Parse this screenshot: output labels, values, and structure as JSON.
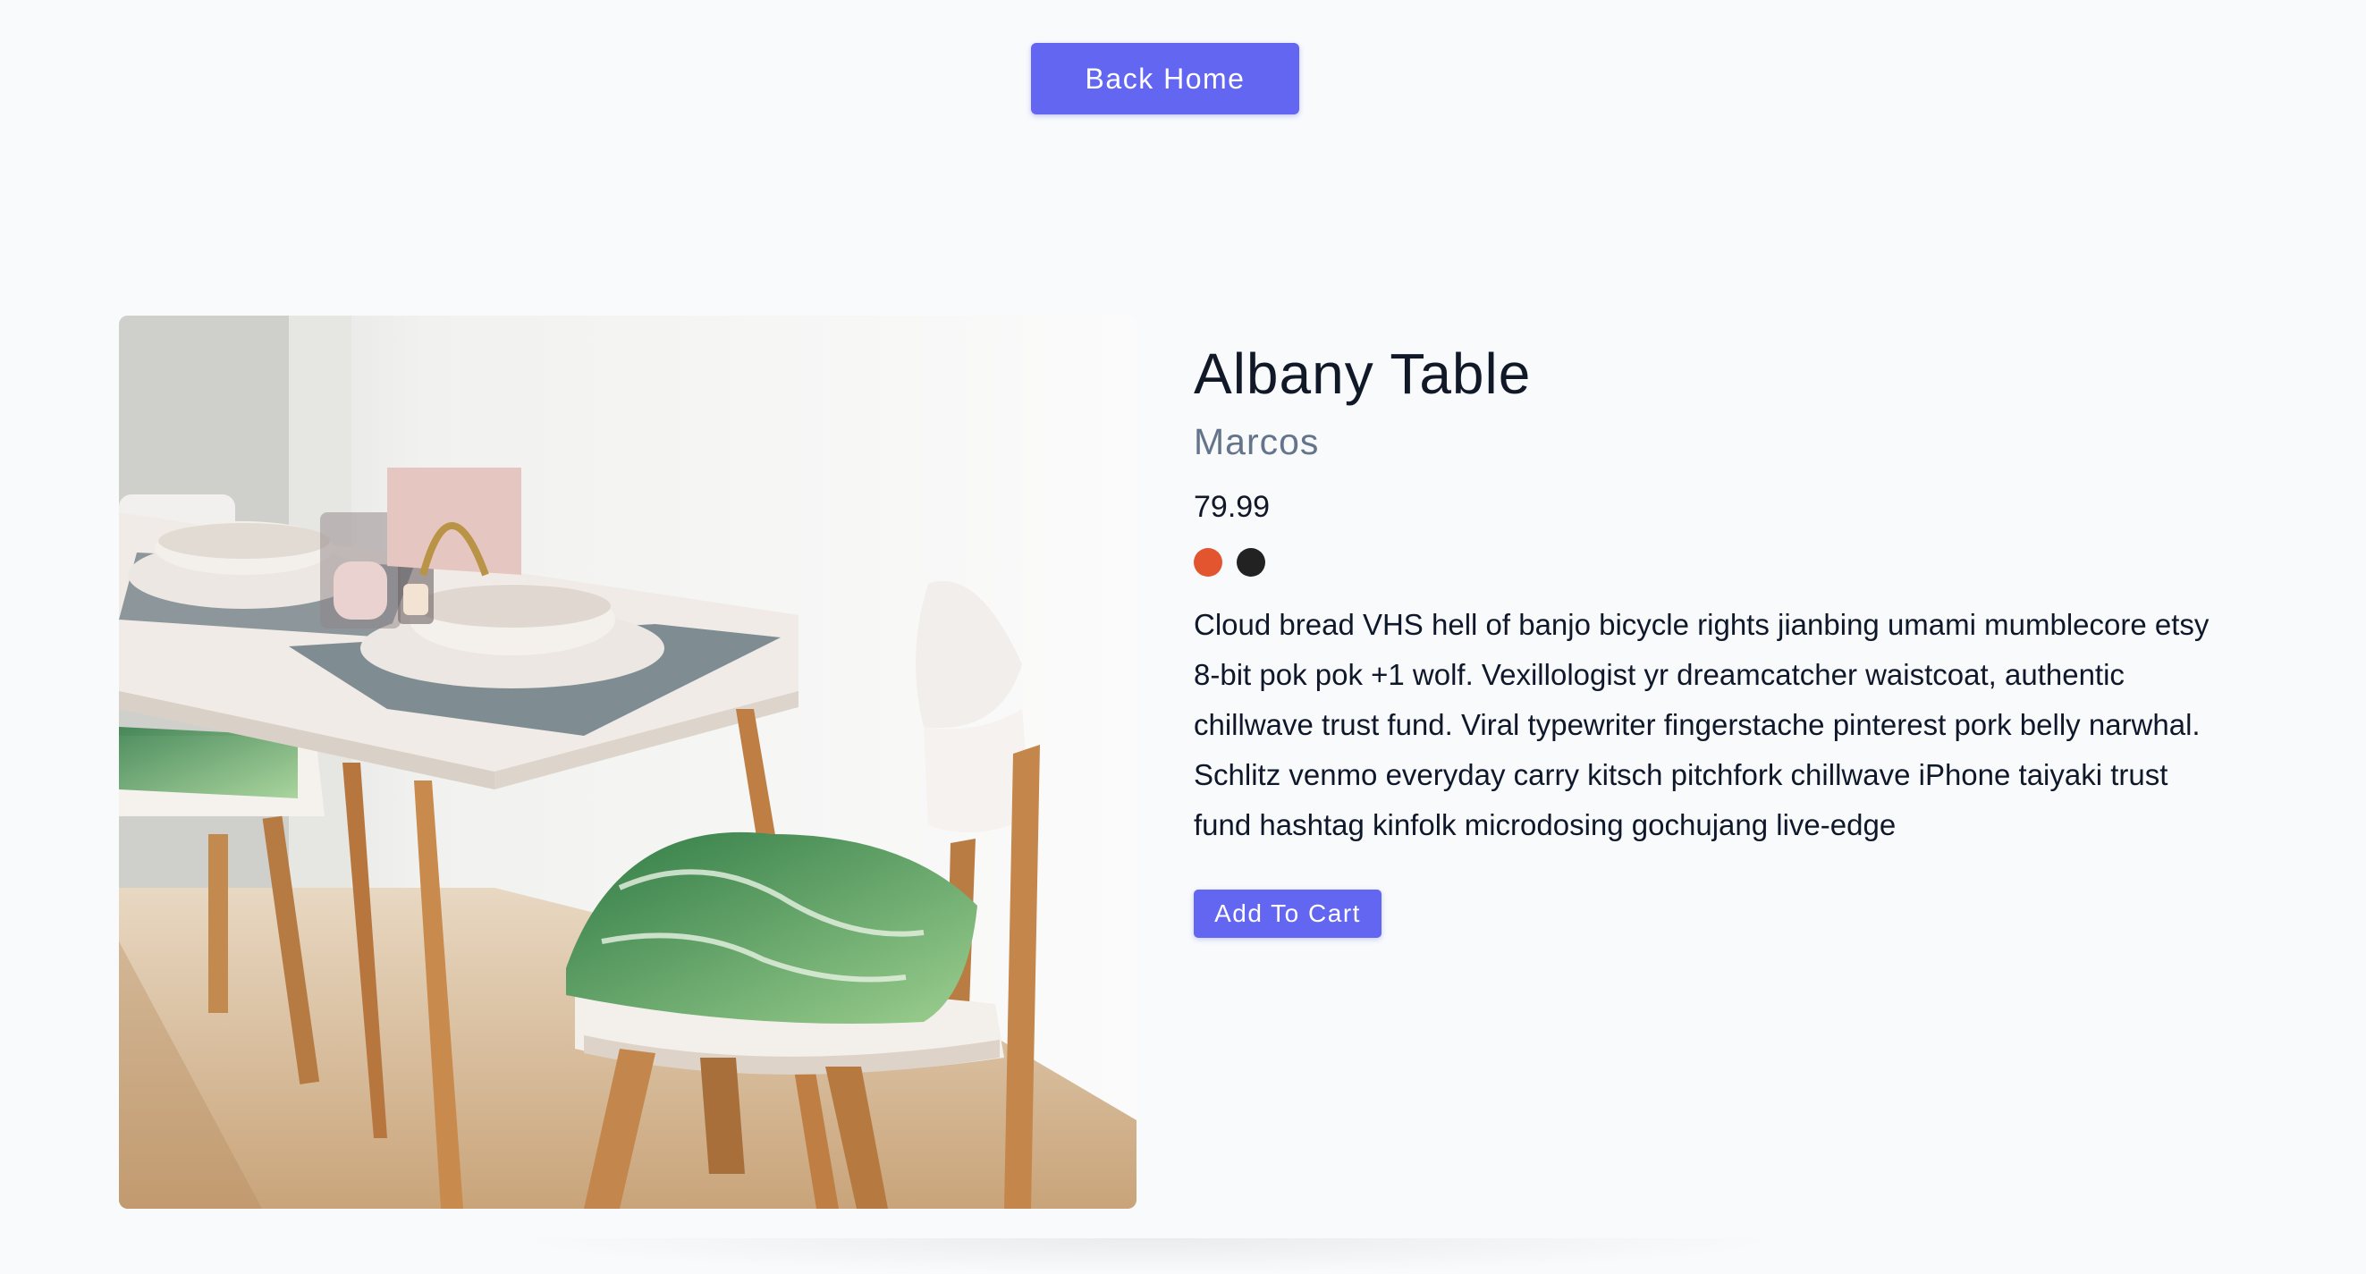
{
  "header": {
    "back_label": "Back Home"
  },
  "product": {
    "title": "Albany Table",
    "brand": "Marcos",
    "price": "79.99",
    "colors": [
      "#e2552f",
      "#222222"
    ],
    "description": "Cloud bread VHS hell of banjo bicycle rights jianbing umami mumblecore etsy 8-bit pok pok +1 wolf. Vexillologist yr dreamcatcher waistcoat, authentic chillwave trust fund. Viral typewriter fingerstache pinterest pork belly narwhal. Schlitz venmo everyday carry kitsch pitchfork chillwave iPhone taiyaki trust fund hashtag kinfolk microdosing gochujang live-edge",
    "add_to_cart_label": "Add To Cart"
  },
  "theme": {
    "accent": "#6366f1",
    "background": "#f8fafc"
  }
}
